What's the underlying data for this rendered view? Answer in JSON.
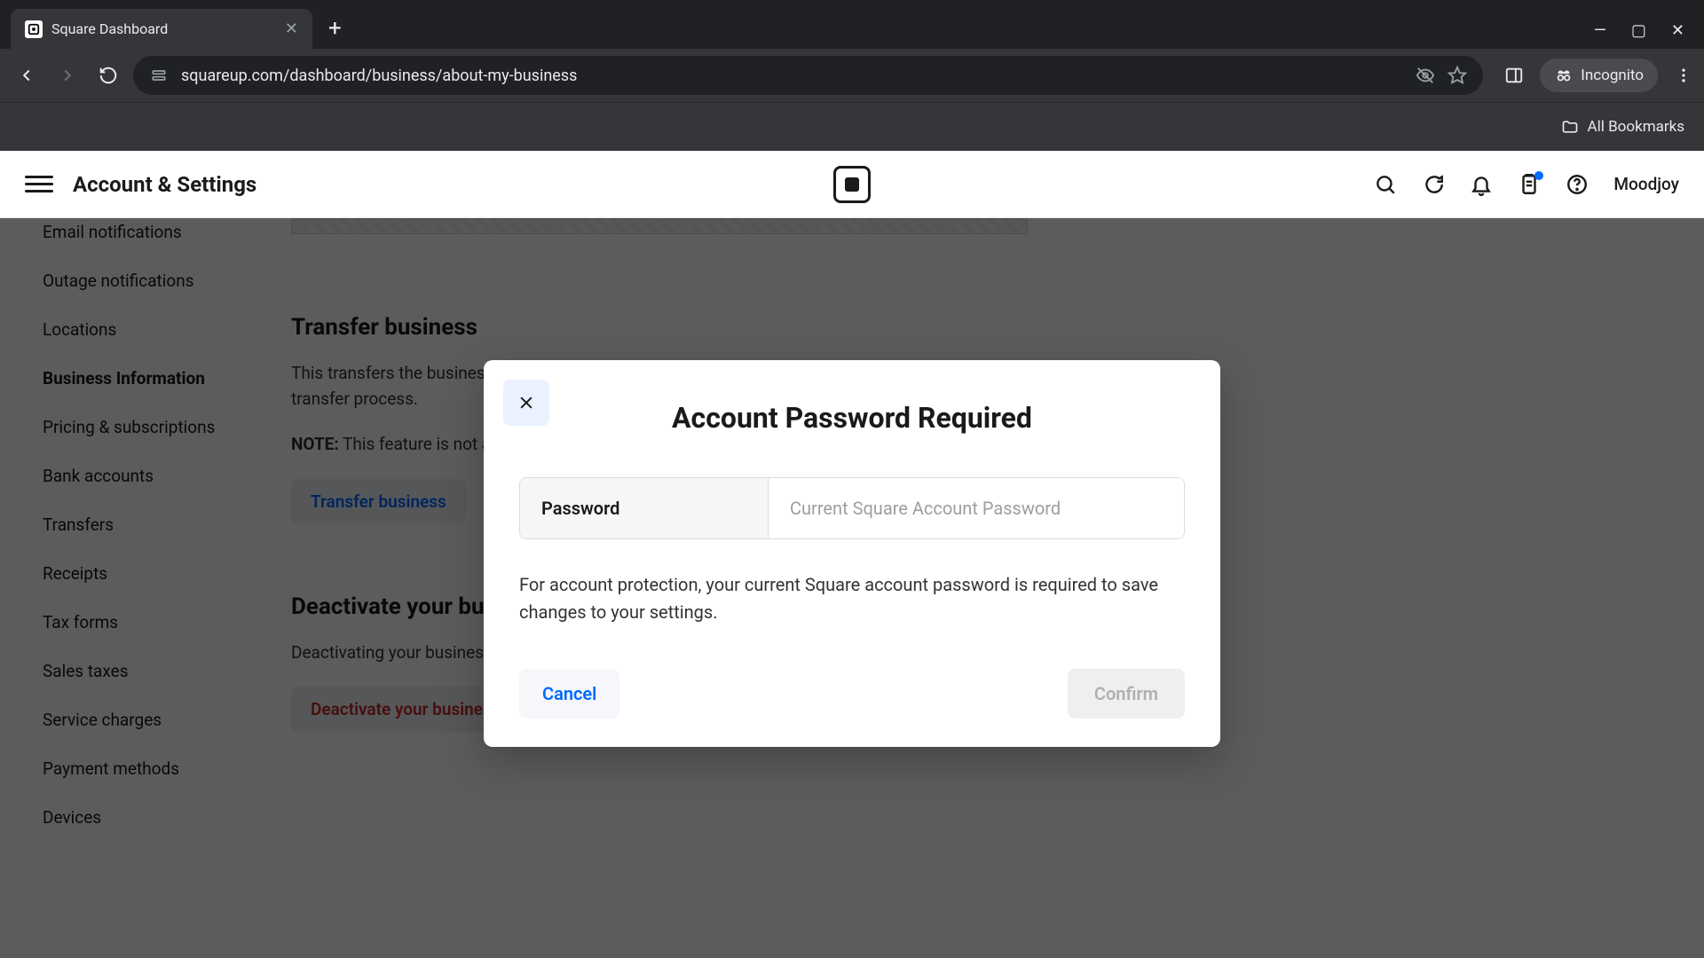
{
  "browser": {
    "tab_title": "Square Dashboard",
    "url": "squareup.com/dashboard/business/about-my-business",
    "incognito_label": "Incognito",
    "bookmarks_label": "All Bookmarks"
  },
  "header": {
    "page_title": "Account & Settings",
    "user_name": "Moodjoy"
  },
  "sidebar": {
    "items": [
      "Email notifications",
      "Outage notifications",
      "Locations",
      "Business Information",
      "Pricing & subscriptions",
      "Bank accounts",
      "Transfers",
      "Receipts",
      "Tax forms",
      "Sales taxes",
      "Service charges",
      "Payment methods",
      "Devices"
    ],
    "active_index": 3
  },
  "content": {
    "transfer": {
      "title": "Transfer business",
      "text": "This transfers the business to a new owner. Square needs to verify the new owner's identity during the transfer process.",
      "note_label": "NOTE:",
      "note_text": " This feature is not available.",
      "button": "Transfer business"
    },
    "deactivate": {
      "title": "Deactivate your business",
      "text": "Deactivating your business will remove your payment history or account information.",
      "button": "Deactivate your business"
    }
  },
  "modal": {
    "title": "Account Password Required",
    "field_label": "Password",
    "placeholder": "Current Square Account Password",
    "description": "For account protection, your current Square account password is required to save changes to your settings.",
    "cancel": "Cancel",
    "confirm": "Confirm"
  }
}
